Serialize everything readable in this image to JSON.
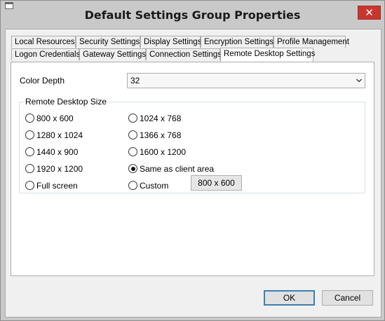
{
  "window": {
    "title": "Default Settings Group Properties",
    "close_glyph": "✕"
  },
  "tabs_row1": [
    {
      "label": "Local Resources"
    },
    {
      "label": "Security Settings"
    },
    {
      "label": "Display Settings"
    },
    {
      "label": "Encryption Settings"
    },
    {
      "label": "Profile Management"
    }
  ],
  "tabs_row2": [
    {
      "label": "Logon Credentials"
    },
    {
      "label": "Gateway Settings"
    },
    {
      "label": "Connection Settings"
    },
    {
      "label": "Remote Desktop Settings",
      "active": true
    }
  ],
  "color_depth": {
    "label": "Color Depth",
    "value": "32"
  },
  "rd_size": {
    "title": "Remote Desktop Size",
    "options": [
      {
        "label": "800 x 600",
        "checked": false
      },
      {
        "label": "1024 x 768",
        "checked": false
      },
      {
        "label": "1280 x 1024",
        "checked": false
      },
      {
        "label": "1366 x 768",
        "checked": false
      },
      {
        "label": "1440 x 900",
        "checked": false
      },
      {
        "label": "1600 x 1200",
        "checked": false
      },
      {
        "label": "1920 x 1200",
        "checked": false
      },
      {
        "label": "Same as client area",
        "checked": true
      },
      {
        "label": "Full screen",
        "checked": false
      },
      {
        "label": "Custom",
        "checked": false
      }
    ],
    "custom_value": "800 x 600"
  },
  "buttons": {
    "ok": "OK",
    "cancel": "Cancel"
  },
  "icons": {
    "app": "app-window-icon",
    "close": "close-icon",
    "dropdown": "chevron-down-icon"
  }
}
